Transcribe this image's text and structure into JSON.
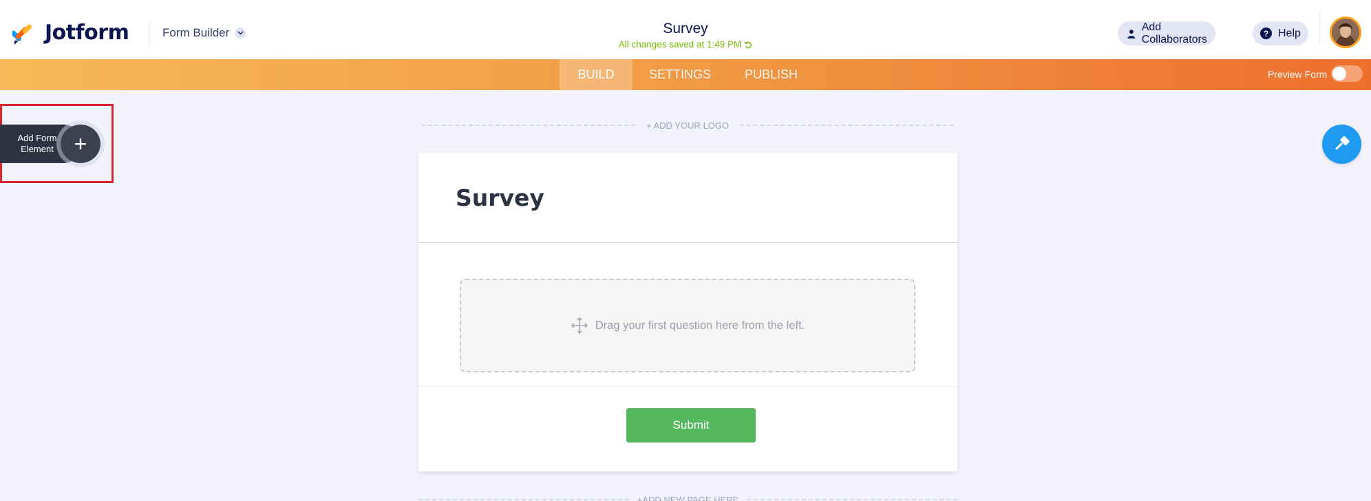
{
  "header": {
    "app_name": "Jotform",
    "builder_menu_label": "Form Builder",
    "form_title": "Survey",
    "save_status": "All changes saved at 1:49 PM",
    "collaborators_label": "Add Collaborators",
    "help_label": "Help"
  },
  "nav": {
    "tabs": [
      {
        "label": "BUILD",
        "active": true
      },
      {
        "label": "SETTINGS",
        "active": false
      },
      {
        "label": "PUBLISH",
        "active": false
      }
    ],
    "preview_label": "Preview Form",
    "preview_enabled": false
  },
  "sidebar": {
    "add_element_line1": "Add Form",
    "add_element_line2": "Element",
    "add_element_icon": "plus-icon"
  },
  "canvas": {
    "add_logo_label": "+ ADD YOUR LOGO",
    "form_heading": "Survey",
    "drop_zone_text": "Drag your first question here from the left.",
    "submit_label": "Submit",
    "add_page_label": "+ADD NEW PAGE HERE"
  },
  "colors": {
    "accent_orange_start": "#f7b957",
    "accent_orange_end": "#ee6f2c",
    "submit_green": "#55b85f",
    "designer_blue": "#1e9bf0",
    "save_status_green": "#78bb07",
    "highlight_red": "#d8272f"
  }
}
